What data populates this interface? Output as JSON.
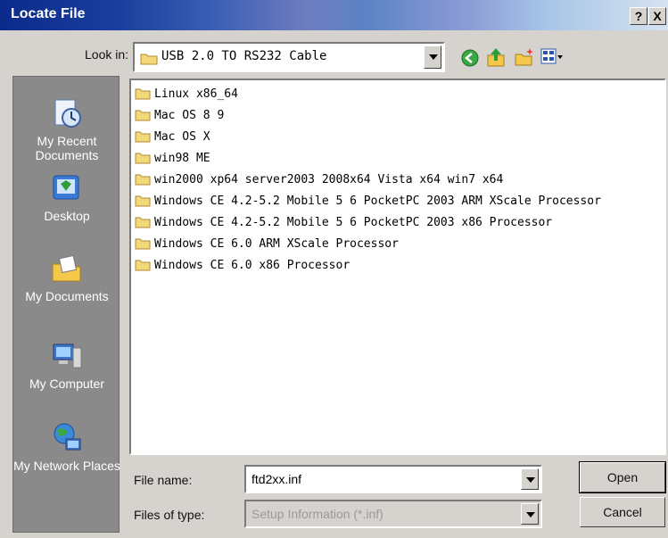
{
  "window": {
    "title": "Locate File",
    "help_btn": "?",
    "close_btn": "X"
  },
  "lookin": {
    "label": "Look in:",
    "value": "USB 2.0 TO RS232 Cable"
  },
  "toolbar": {
    "icons": [
      "back-icon",
      "up-folder-icon",
      "new-folder-icon",
      "view-menu-icon"
    ]
  },
  "places": [
    {
      "label": "My Recent Documents",
      "icon": "recent-documents-icon"
    },
    {
      "label": "Desktop",
      "icon": "desktop-icon"
    },
    {
      "label": "My Documents",
      "icon": "my-documents-icon"
    },
    {
      "label": "My Computer",
      "icon": "my-computer-icon"
    },
    {
      "label": "My Network Places",
      "icon": "network-places-icon"
    }
  ],
  "files": [
    "Linux x86_64",
    "Mac OS 8 9",
    "Mac OS X",
    "win98 ME",
    "win2000 xp64 server2003 2008x64 Vista x64 win7 x64",
    "Windows CE 4.2-5.2 Mobile 5 6 PocketPC 2003 ARM XScale Processor",
    "Windows CE 4.2-5.2 Mobile 5 6 PocketPC 2003 x86 Processor",
    "Windows CE 6.0 ARM XScale Processor",
    "Windows CE 6.0 x86 Processor"
  ],
  "filename": {
    "label": "File name:",
    "value": "ftd2xx.inf"
  },
  "filetype": {
    "label": "Files of type:",
    "value": "Setup Information (*.inf)"
  },
  "buttons": {
    "open": "Open",
    "cancel": "Cancel"
  },
  "colors": {
    "places_bg": "#8a8a8a",
    "dialog_bg": "#d6d3ce",
    "title_start": "#0c2a8a"
  }
}
